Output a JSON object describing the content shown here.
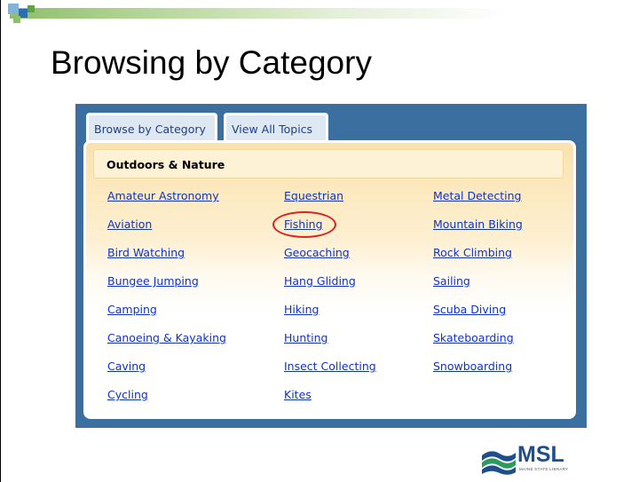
{
  "slide": {
    "title": "Browsing by Category"
  },
  "tabs": {
    "browse": "Browse by Category",
    "all": "View All Topics"
  },
  "category": {
    "heading": "Outdoors & Nature",
    "columns": [
      [
        "Amateur Astronomy",
        "Aviation",
        "Bird Watching",
        "Bungee Jumping",
        "Camping",
        "Canoeing & Kayaking",
        "Caving",
        "Cycling"
      ],
      [
        "Equestrian",
        "Fishing",
        "Geocaching",
        "Hang Gliding",
        "Hiking",
        "Hunting",
        "Insect Collecting",
        "Kites"
      ],
      [
        "Metal Detecting",
        "Mountain Biking",
        "Rock Climbing",
        "Sailing",
        "Scuba Diving",
        "Skateboarding",
        "Snowboarding"
      ]
    ],
    "highlighted": "Fishing",
    "highlight_color": "#e02020"
  },
  "logo": {
    "text": "MSL",
    "subtext": "MAINE STATE LIBRARY"
  },
  "colors": {
    "panel": "#3b6fa0",
    "link": "#1033c4",
    "title_bar": "#8fbf6a"
  }
}
